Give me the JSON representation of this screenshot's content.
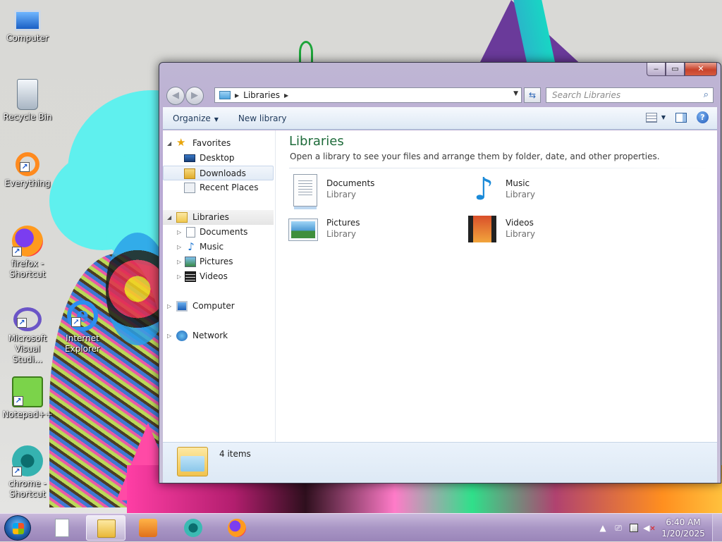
{
  "desktop": {
    "icons": [
      {
        "label": "Computer"
      },
      {
        "label": "Recycle Bin"
      },
      {
        "label": "Everything"
      },
      {
        "label": "firefox - Shortcut"
      },
      {
        "label": "Microsoft Visual Studi..."
      },
      {
        "label": "Internet Explorer"
      },
      {
        "label": "Notepad++"
      },
      {
        "label": "chrome - Shortcut"
      }
    ]
  },
  "window": {
    "caption": {
      "minimize": "‒",
      "maximize": "▭",
      "close": "✕"
    },
    "address": {
      "path": "Libraries"
    },
    "search": {
      "placeholder": "Search Libraries"
    },
    "toolbar": {
      "organize": "Organize",
      "new_library": "New library"
    },
    "nav": {
      "favorites": "Favorites",
      "desktop": "Desktop",
      "downloads": "Downloads",
      "recent_places": "Recent Places",
      "libraries": "Libraries",
      "documents": "Documents",
      "music": "Music",
      "pictures": "Pictures",
      "videos": "Videos",
      "computer": "Computer",
      "network": "Network"
    },
    "content": {
      "title": "Libraries",
      "description": "Open a library to see your files and arrange them by folder, date, and other properties.",
      "libraries": [
        {
          "name": "Documents",
          "type": "Library"
        },
        {
          "name": "Music",
          "type": "Library"
        },
        {
          "name": "Pictures",
          "type": "Library"
        },
        {
          "name": "Videos",
          "type": "Library"
        }
      ]
    },
    "status": {
      "text": "4 items"
    }
  },
  "taskbar": {
    "clock": {
      "time": "6:40 AM",
      "date": "1/20/2025"
    }
  }
}
